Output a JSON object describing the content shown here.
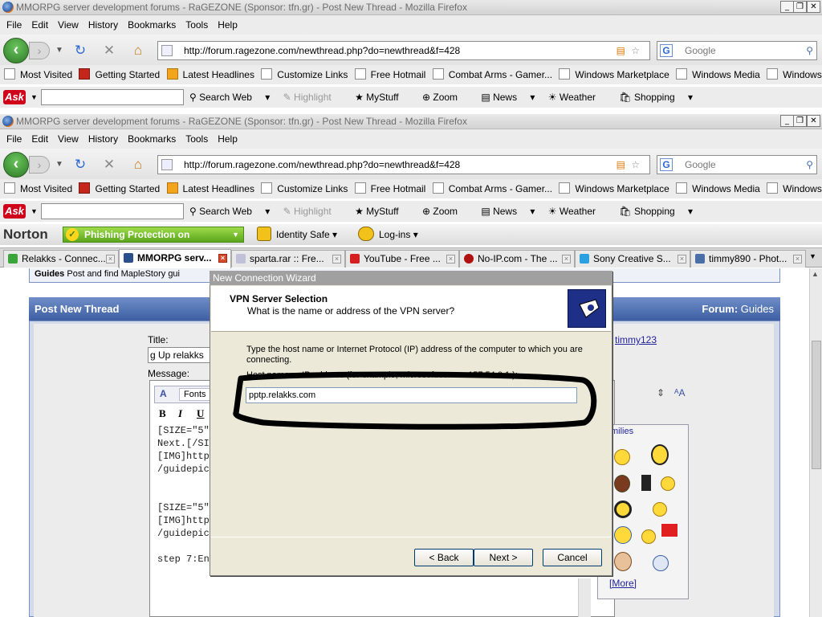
{
  "window": {
    "title": "MMORPG server development forums - RaGEZONE (Sponsor: tfn.gr) - Post New Thread - Mozilla Firefox"
  },
  "menu": [
    "File",
    "Edit",
    "View",
    "History",
    "Bookmarks",
    "Tools",
    "Help"
  ],
  "nav": {
    "url": "http://forum.ragezone.com/newthread.php?do=newthread&f=428",
    "search_placeholder": "Google"
  },
  "bookmarks": [
    "Most Visited",
    "Getting Started",
    "Latest Headlines",
    "Customize Links",
    "Free Hotmail",
    "Combat Arms - Gamer...",
    "Windows Marketplace",
    "Windows Media",
    "Windows"
  ],
  "ask_toolbar": {
    "logo": "Ask",
    "search_web": "Search Web",
    "highlight": "Highlight",
    "mystuff": "MyStuff",
    "zoom": "Zoom",
    "news": "News",
    "weather": "Weather",
    "shopping": "Shopping"
  },
  "norton": {
    "logo": "Norton",
    "phishing": "Phishing Protection on",
    "identity_safe": "Identity Safe",
    "logins": "Log-ins"
  },
  "tabs": [
    {
      "label": "Relakks - Connec...",
      "active": false
    },
    {
      "label": "MMORPG serv...",
      "active": true
    },
    {
      "label": "sparta.rar :: Fre...",
      "active": false
    },
    {
      "label": "YouTube - Free ...",
      "active": false
    },
    {
      "label": "No-IP.com - The ...",
      "active": false
    },
    {
      "label": "Sony Creative S...",
      "active": false
    },
    {
      "label": "timmy890 - Phot...",
      "active": false
    }
  ],
  "forum": {
    "guides_title": "Guides",
    "guides_desc": "Post and find MapleStory gui",
    "header": "Post New Thread",
    "forum_label": "Forum:",
    "forum_name": "Guides",
    "title_label": "Title:",
    "title_value": "g Up relakks",
    "message_label": "Message:",
    "user": "timmy123",
    "fonts_label": "Fonts",
    "bold": "B",
    "italic": "I",
    "underline": "U",
    "smilies_label": "milies",
    "more_link": "[More]",
    "message_lines": [
      "[SIZE=\"5\"",
      "Next.[/SIZ",
      "[IMG]http",
      "/guidepic5",
      "",
      "",
      "[SIZE=\"5\"",
      "[IMG]http",
      "/guidepic6",
      "",
      "step 7:En"
    ]
  },
  "dialog": {
    "title": "New Connection Wizard",
    "heading": "VPN Server Selection",
    "subheading": "What is the name or address of the VPN server?",
    "instruction": "Type the host name or Internet Protocol (IP) address of the computer to which you are connecting.",
    "field_label": "Host name or IP address (for example, microsoft.com or 157.54.0.1 ):",
    "field_value": "pptp.relakks.com",
    "back": "< Back",
    "next": "Next >",
    "cancel": "Cancel"
  }
}
